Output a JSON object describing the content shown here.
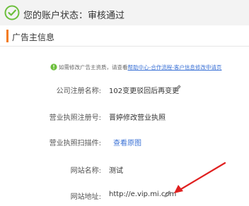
{
  "status": {
    "text": "您的账户状态：审核通过"
  },
  "section": {
    "title": "广告主信息"
  },
  "notice": {
    "prefix": "如需修改广告主资质，请查看",
    "link": "帮助中心-合作流程-客户信息修改申请页"
  },
  "rows": [
    {
      "label": "公司注册名称:",
      "value": "102变更驳回后再变更"
    },
    {
      "label": "营业执照注册号:",
      "value": "晋婷修改营业执照"
    },
    {
      "label": "营业执照扫描件:",
      "value": "查看原图"
    },
    {
      "label": "网站名称:",
      "value": "测试"
    },
    {
      "label": "网站地址:",
      "value": "http://e.vip.mi.com"
    }
  ],
  "colors": {
    "success": "#6cbf3c",
    "accent": "#f37b1d",
    "link": "#3b72d6",
    "annotation_arrow": "#e02020"
  },
  "icons": {
    "status": "check-circle-icon",
    "notice": "info-icon",
    "edit": "pencil-icon"
  }
}
